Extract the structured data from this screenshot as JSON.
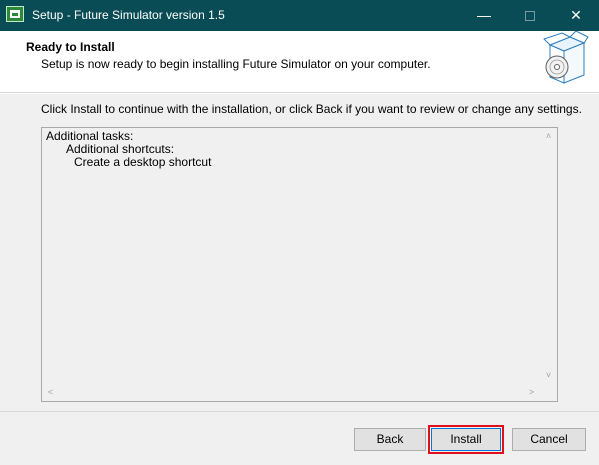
{
  "window": {
    "title": "Setup - Future Simulator version 1.5",
    "controls": {
      "minimize": "—",
      "maximize": "",
      "close": "✕"
    }
  },
  "header": {
    "title": "Ready to Install",
    "subtitle": "Setup is now ready to begin installing Future Simulator on your computer."
  },
  "body": {
    "instruction": "Click Install to continue with the installation, or click Back if you want to review or change any settings.",
    "memo": {
      "line1": "Additional tasks:",
      "line2": "Additional shortcuts:",
      "line3": "Create a desktop shortcut"
    },
    "scroll": {
      "up": "˄",
      "down": "˅",
      "left": "<",
      "right": ">"
    }
  },
  "buttons": {
    "back": "Back",
    "install": "Install",
    "cancel": "Cancel"
  },
  "colors": {
    "titlebar": "#0a4c55",
    "highlight": "#e0101c",
    "focus": "#0078d7"
  }
}
